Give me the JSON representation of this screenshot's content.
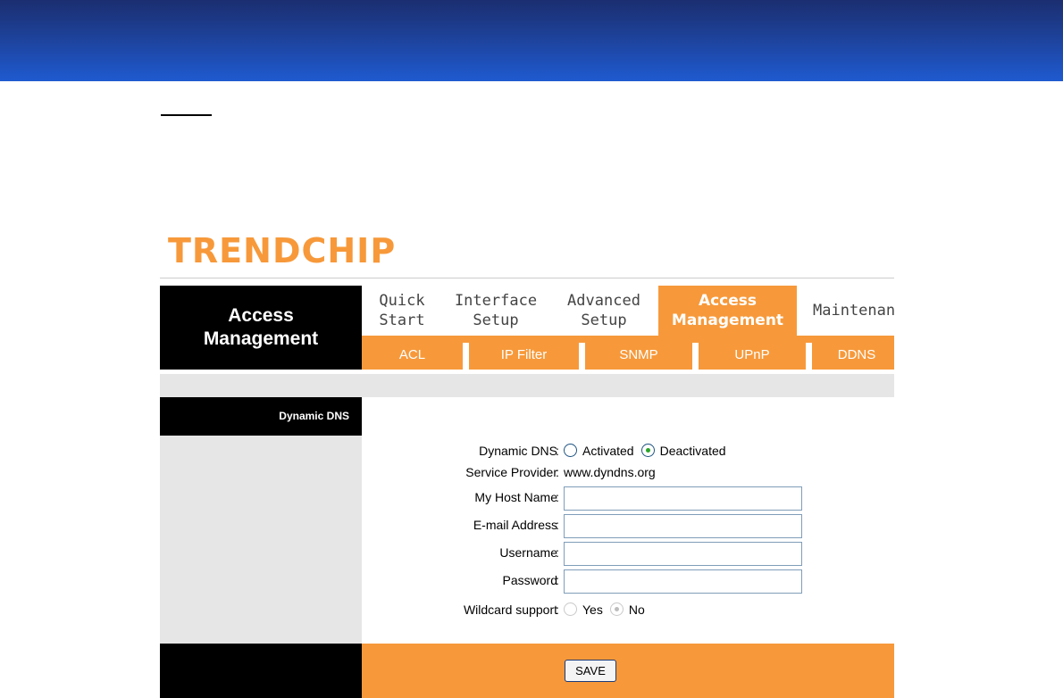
{
  "brand": {
    "logo_text": "TRENDCHIP"
  },
  "left_header": {
    "line1": "Access",
    "line2": "Management"
  },
  "tabs": [
    {
      "line1": "Quick",
      "line2": "Start"
    },
    {
      "line1": "Interface",
      "line2": "Setup"
    },
    {
      "line1": "Advanced",
      "line2": "Setup"
    },
    {
      "line1": "Access",
      "line2": "Management",
      "active": true
    },
    {
      "line1": "Maintenance",
      "line2": ""
    }
  ],
  "subtabs": [
    "ACL",
    "IP Filter",
    "SNMP",
    "UPnP",
    "DDNS"
  ],
  "section": {
    "label": "Dynamic DNS"
  },
  "form": {
    "dynamic_dns": {
      "label": "Dynamic DNS",
      "options": [
        {
          "label": "Activated",
          "checked": false
        },
        {
          "label": "Deactivated",
          "checked": true
        }
      ]
    },
    "service_provider": {
      "label": "Service Provider",
      "value": "www.dyndns.org"
    },
    "host_name": {
      "label": "My Host Name",
      "value": ""
    },
    "email": {
      "label": "E-mail Address",
      "value": ""
    },
    "username": {
      "label": "Username",
      "value": ""
    },
    "password": {
      "label": "Password",
      "value": ""
    },
    "wildcard": {
      "label": "Wildcard support",
      "options": [
        {
          "label": "Yes",
          "checked": false
        },
        {
          "label": "No",
          "checked": true
        }
      ]
    }
  },
  "save_button": {
    "label": "SAVE"
  },
  "colors": {
    "accent": "#f7993a",
    "banner": "#1f5ad0",
    "black": "#000000",
    "grey": "#e6e6e6"
  }
}
